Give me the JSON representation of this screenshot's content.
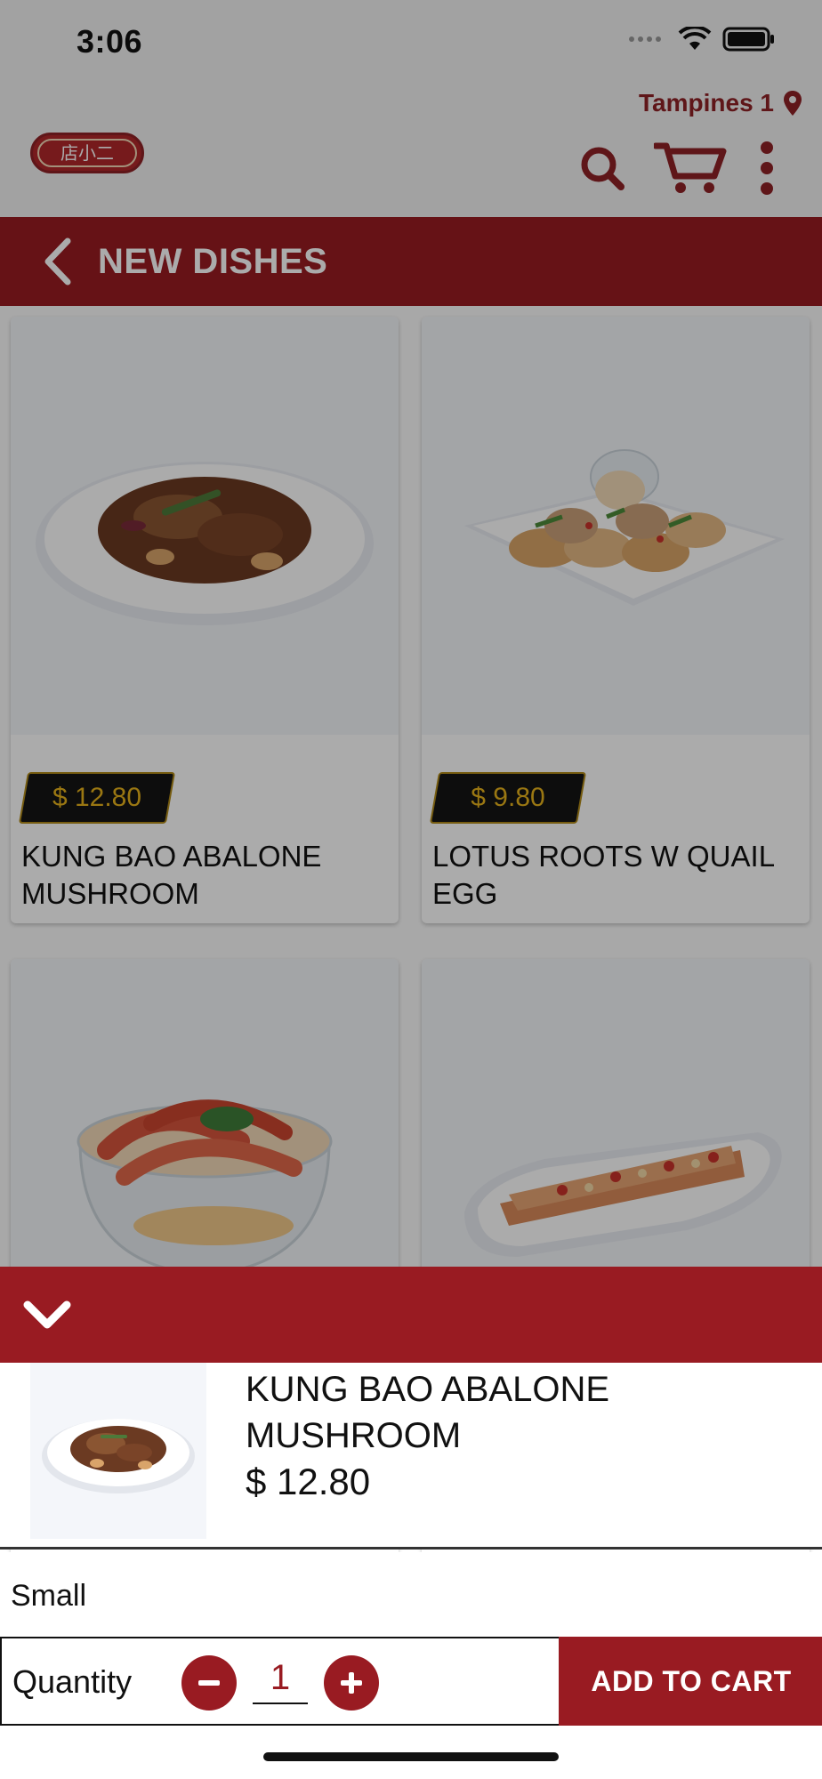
{
  "status": {
    "time": "3:06"
  },
  "header": {
    "location": "Tampines 1",
    "logo_text": "店小二",
    "icons": {
      "location": "location-pin-icon",
      "search": "search-icon",
      "cart": "cart-icon",
      "menu": "more-vertical-icon"
    }
  },
  "page": {
    "title": "NEW DISHES"
  },
  "dishes": [
    {
      "price": "$ 12.80",
      "name": "KUNG BAO ABALONE MUSHROOM"
    },
    {
      "price": "$ 9.80",
      "name": "LOTUS ROOTS W QUAIL EGG"
    },
    {
      "price": "",
      "name": ""
    },
    {
      "price": "",
      "name": ""
    }
  ],
  "sheet": {
    "product_name": "KUNG BAO ABALONE MUSHROOM",
    "product_price": "$ 12.80",
    "size": "Small",
    "quantity_label": "Quantity",
    "quantity": "1",
    "add_to_cart": "ADD TO CART"
  },
  "colors": {
    "brand": "#991b22",
    "price_text": "#e6b21c",
    "price_bg": "#141414"
  }
}
